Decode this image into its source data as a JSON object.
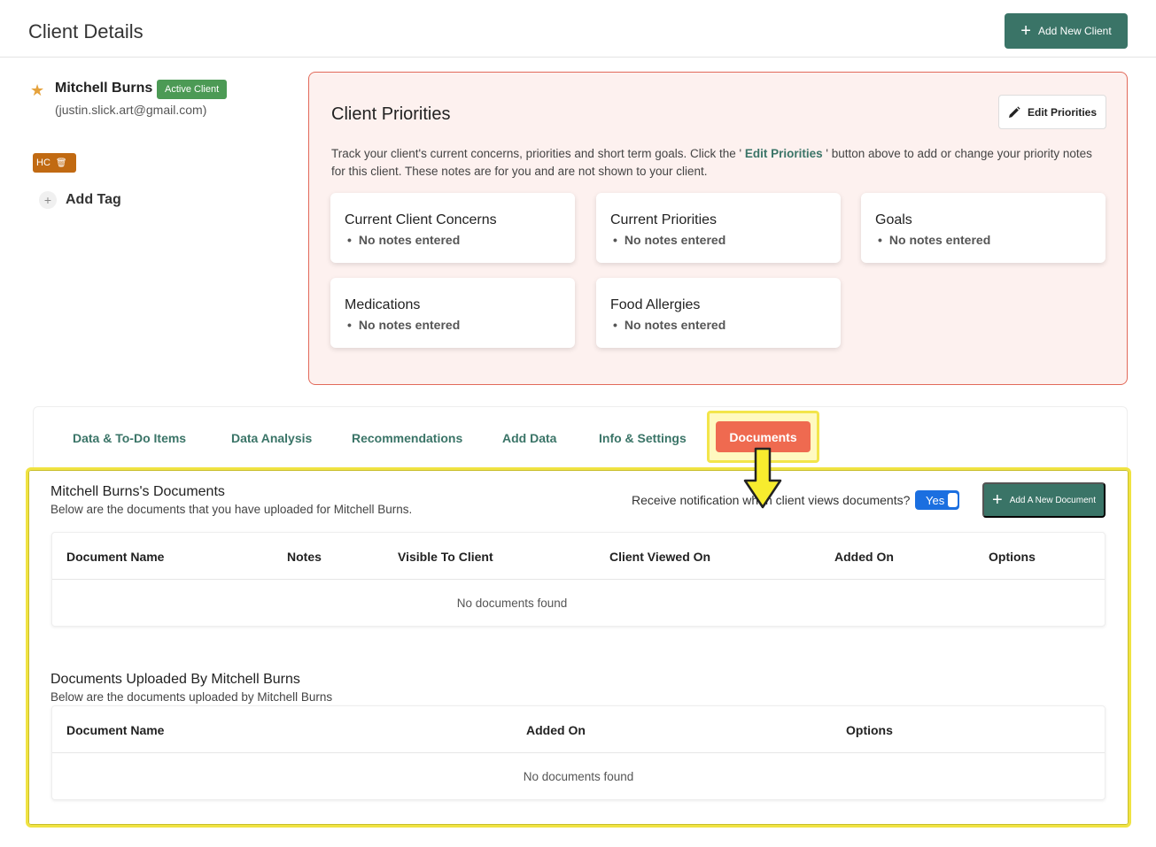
{
  "header": {
    "title": "Client Details",
    "add_client_label": "Add New Client"
  },
  "client": {
    "name": "Mitchell Burns",
    "status": "Active Client",
    "email": "(justin.slick.art@gmail.com)",
    "tag": "HC",
    "add_tag_label": "Add Tag"
  },
  "priorities": {
    "title": "Client Priorities",
    "edit_label": "Edit Priorities",
    "desc_before": "Track your client's current concerns, priorities and short term goals. Click the '",
    "desc_link": "Edit Priorities",
    "desc_after": "' button above to add or change your priority notes for this client. These notes are for you and are not shown to your client.",
    "cards": [
      {
        "title": "Current Client Concerns",
        "note": "No notes entered"
      },
      {
        "title": "Current Priorities",
        "note": "No notes entered"
      },
      {
        "title": "Goals",
        "note": "No notes entered"
      },
      {
        "title": "Medications",
        "note": "No notes entered"
      },
      {
        "title": "Food Allergies",
        "note": "No notes entered"
      }
    ]
  },
  "tabs": [
    "Data & To-Do Items",
    "Data Analysis",
    "Recommendations",
    "Add Data",
    "Info & Settings",
    "Documents"
  ],
  "documents": {
    "title": "Mitchell Burns's Documents",
    "subtitle": "Below are the documents that you have uploaded for Mitchell Burns.",
    "notif_label": "Receive notification when client views documents?",
    "toggle_value": "Yes",
    "add_label": "Add A New Document",
    "columns": [
      "Document Name",
      "Notes",
      "Visible To Client",
      "Client Viewed On",
      "Added On",
      "Options"
    ],
    "empty": "No documents found"
  },
  "uploaded": {
    "title": "Documents Uploaded By Mitchell Burns",
    "subtitle": "Below are the documents uploaded by Mitchell Burns",
    "columns": [
      "Document Name",
      "Added On",
      "Options"
    ],
    "empty": "No documents found"
  },
  "colors": {
    "accent": "#3a7467",
    "active_tab": "#ef6a50",
    "highlight": "#f0e342",
    "status": "#4c9a55",
    "tag": "#c16a12"
  }
}
